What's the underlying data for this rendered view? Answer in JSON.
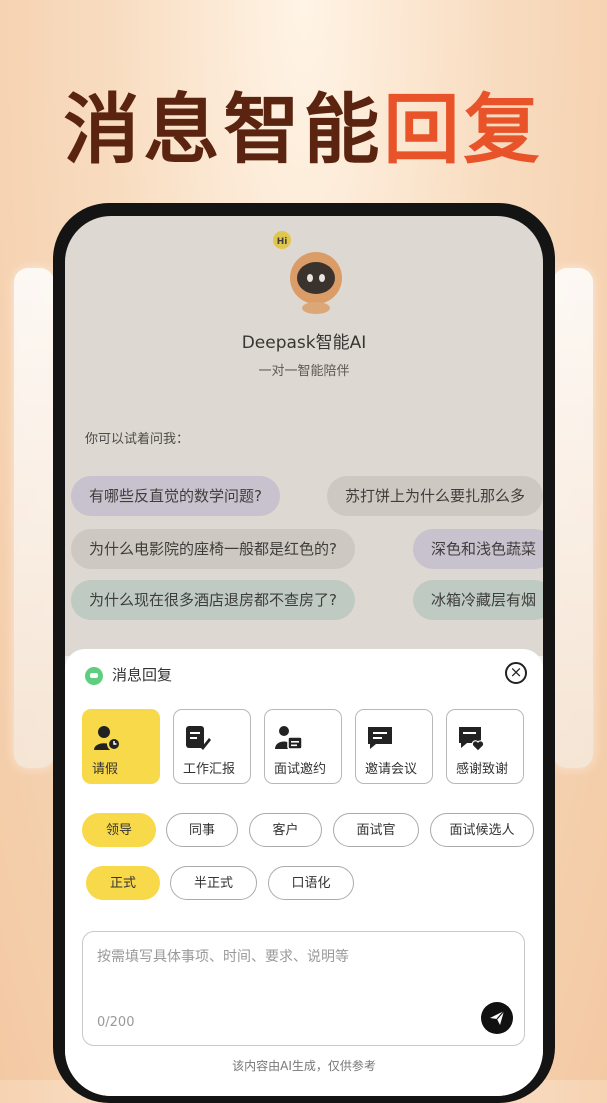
{
  "headline": {
    "part1": "消息智能",
    "part2": "回复"
  },
  "app": {
    "name": "Deepask智能AI",
    "subtitle": "一对一智能陪伴",
    "mascot_badge": "Hi"
  },
  "suggest": {
    "label": "你可以试着问我：",
    "rows": [
      [
        "有哪些反直觉的数学问题?",
        "苏打饼上为什么要扎那么多"
      ],
      [
        "为什么电影院的座椅一般都是红色的?",
        "深色和浅色蔬菜"
      ],
      [
        "为什么现在很多酒店退房都不查房了?",
        "冰箱冷藏层有烟"
      ]
    ]
  },
  "sheet": {
    "title": "消息回复",
    "categories": [
      {
        "label": "请假",
        "icon": "person-clock-icon",
        "selected": true
      },
      {
        "label": "工作汇报",
        "icon": "document-edit-icon",
        "selected": false
      },
      {
        "label": "面试邀约",
        "icon": "person-card-icon",
        "selected": false
      },
      {
        "label": "邀请会议",
        "icon": "chat-lines-icon",
        "selected": false
      },
      {
        "label": "感谢致谢",
        "icon": "chat-heart-icon",
        "selected": false
      }
    ],
    "recipients": [
      {
        "label": "领导",
        "selected": true
      },
      {
        "label": "同事",
        "selected": false
      },
      {
        "label": "客户",
        "selected": false
      },
      {
        "label": "面试官",
        "selected": false
      },
      {
        "label": "面试候选人",
        "selected": false
      }
    ],
    "tones": [
      {
        "label": "正式",
        "selected": true
      },
      {
        "label": "半正式",
        "selected": false
      },
      {
        "label": "口语化",
        "selected": false
      }
    ],
    "input": {
      "placeholder": "按需填写具体事项、时间、要求、说明等",
      "counter": "0/200"
    },
    "footer": "该内容由AI生成，仅供参考"
  },
  "colors": {
    "accent": "#f8d94a",
    "headline_dark": "#5a2410",
    "headline_orange": "#e8532a"
  }
}
